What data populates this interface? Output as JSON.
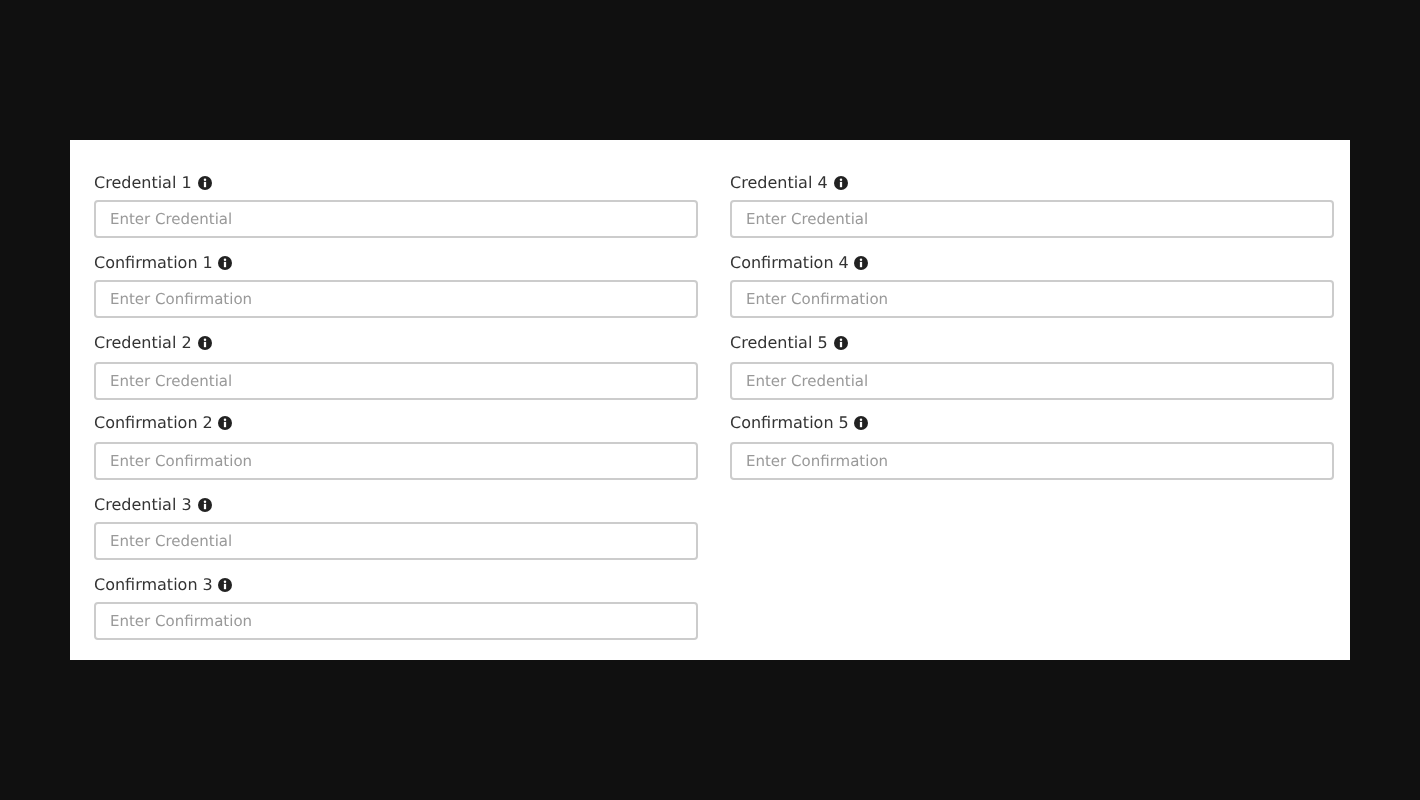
{
  "columns": [
    {
      "fields": [
        {
          "label": "Credential 1",
          "placeholder": "Enter Credential"
        },
        {
          "label": "Confirmation 1",
          "placeholder": "Enter Confirmation"
        },
        {
          "label": "Credential 2",
          "placeholder": "Enter Credential"
        },
        {
          "label": "Confirmation 2",
          "placeholder": "Enter Confirmation"
        },
        {
          "label": "Credential 3",
          "placeholder": "Enter Credential"
        },
        {
          "label": "Confirmation 3",
          "placeholder": "Enter Confirmation"
        }
      ]
    },
    {
      "fields": [
        {
          "label": "Credential 4",
          "placeholder": "Enter Credential"
        },
        {
          "label": "Confirmation 4",
          "placeholder": "Enter Confirmation"
        },
        {
          "label": "Credential 5",
          "placeholder": "Enter Credential"
        },
        {
          "label": "Confirmation 5",
          "placeholder": "Enter Confirmation"
        }
      ]
    }
  ]
}
